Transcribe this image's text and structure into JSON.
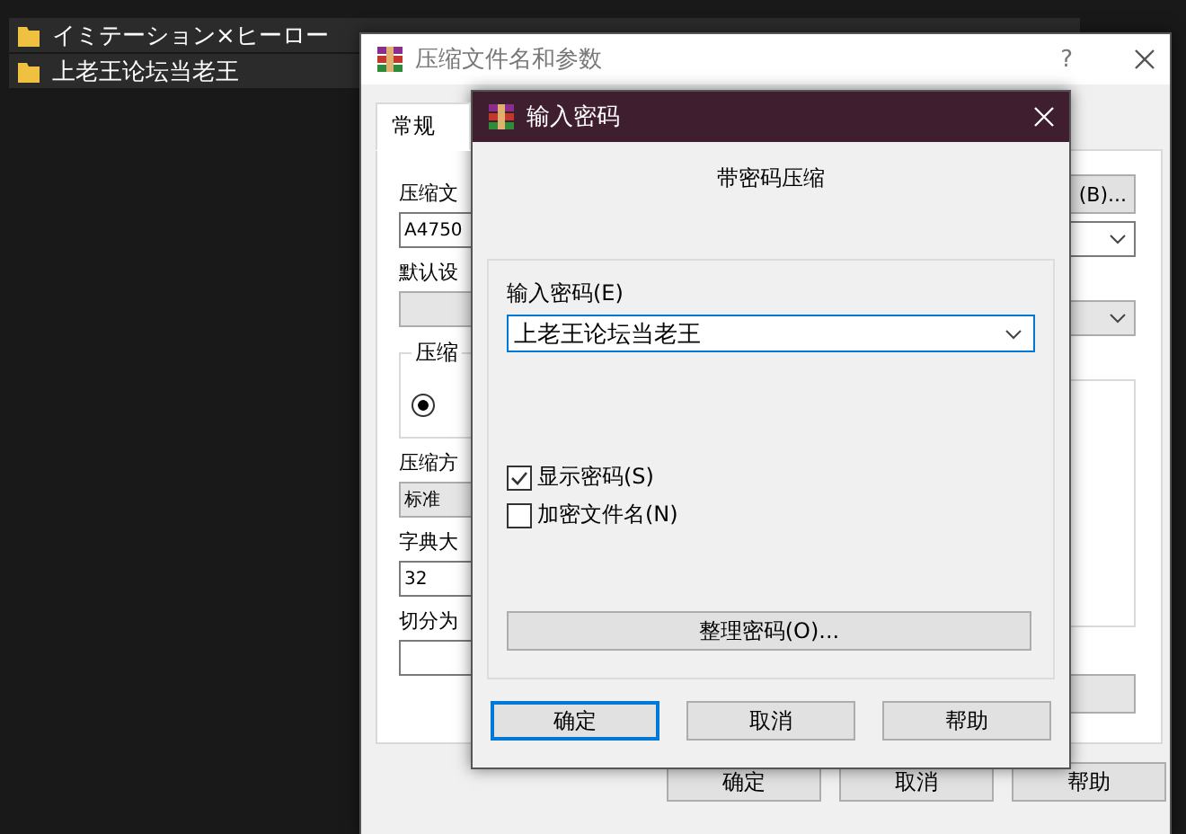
{
  "explorer": {
    "rows": [
      {
        "name": "イミテーション×ヒーロー"
      },
      {
        "name": "上老王论坛当老王"
      }
    ]
  },
  "back_dialog": {
    "title": "压缩文件名和参数",
    "help": "?",
    "tabs": [
      {
        "label": "常规",
        "selected": true
      }
    ],
    "left_items": [
      {
        "kind": "label",
        "text": "压缩文"
      },
      {
        "kind": "field",
        "text": "A4750"
      },
      {
        "kind": "label",
        "text": "默认设"
      },
      {
        "kind": "select"
      },
      {
        "kind": "group",
        "text": "压缩",
        "radio_selected": true
      },
      {
        "kind": "label",
        "text": "压缩方"
      },
      {
        "kind": "select",
        "text": "标准"
      },
      {
        "kind": "label",
        "text": "字典大"
      },
      {
        "kind": "field",
        "text": "32"
      },
      {
        "kind": "label",
        "text": "切分为"
      },
      {
        "kind": "field"
      }
    ],
    "browse_button": "(B)...",
    "buttons": [
      "确定",
      "取消",
      "帮助"
    ]
  },
  "password_dialog": {
    "title": "输入密码",
    "heading": "带密码压缩",
    "field_label": "输入密码(E)",
    "password": "上老王论坛当老王",
    "checkboxes": [
      {
        "label": "显示密码(S)",
        "checked": true
      },
      {
        "label": "加密文件名(N)",
        "checked": false
      }
    ],
    "organize_button": "整理密码(O)...",
    "buttons": [
      {
        "label": "确定",
        "focused": true
      },
      {
        "label": "取消",
        "focused": false
      },
      {
        "label": "帮助",
        "focused": false
      }
    ]
  }
}
